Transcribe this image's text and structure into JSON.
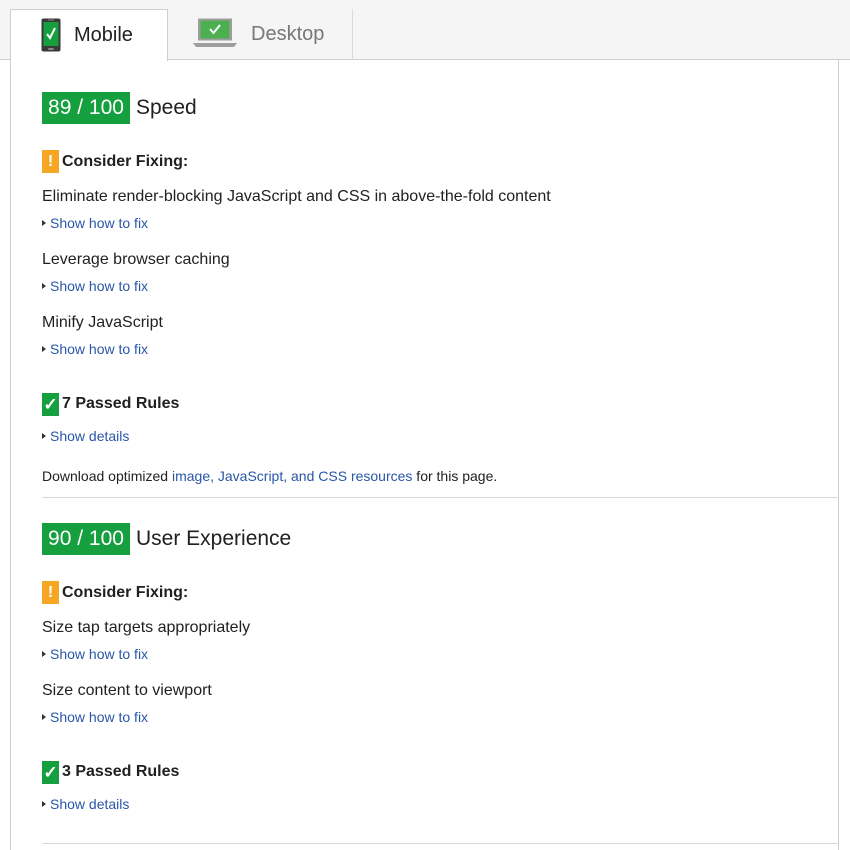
{
  "tabs": [
    {
      "label": "Mobile",
      "icon": "mobile-phone-check-icon",
      "active": true
    },
    {
      "label": "Desktop",
      "icon": "desktop-monitor-check-icon",
      "active": false
    }
  ],
  "colors": {
    "score_green": "#159f3f",
    "warning_orange": "#f5a623",
    "link_blue": "#2a56a8"
  },
  "speed": {
    "score": "89 / 100",
    "title": "Speed",
    "consider_label": "Consider Fixing:",
    "rules": [
      {
        "title": "Eliminate render-blocking JavaScript and CSS in above-the-fold content",
        "link": "Show how to fix"
      },
      {
        "title": "Leverage browser caching",
        "link": "Show how to fix"
      },
      {
        "title": "Minify JavaScript",
        "link": "Show how to fix"
      }
    ],
    "passed_label": "7 Passed Rules",
    "passed_link": "Show details",
    "download_prefix": "Download optimized ",
    "download_link": "image, JavaScript, and CSS resources",
    "download_suffix": " for this page."
  },
  "ux": {
    "score": "90 / 100",
    "title": "User Experience",
    "consider_label": "Consider Fixing:",
    "rules": [
      {
        "title": "Size tap targets appropriately",
        "link": "Show how to fix"
      },
      {
        "title": "Size content to viewport",
        "link": "Show how to fix"
      }
    ],
    "passed_label": "3 Passed Rules",
    "passed_link": "Show details"
  }
}
